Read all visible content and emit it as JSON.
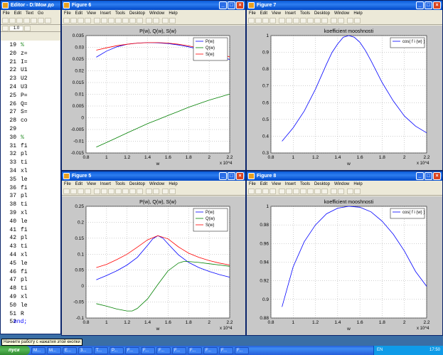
{
  "editor": {
    "title": "Editor - D:\\Мои до",
    "menu": [
      "File",
      "Edit",
      "Text",
      "Go"
    ],
    "zoom_value": "1.0",
    "lines": [
      {
        "n": "19",
        "t": "%"
      },
      {
        "n": "20",
        "t": "z="
      },
      {
        "n": "21",
        "t": "I="
      },
      {
        "n": "22",
        "t": "U1"
      },
      {
        "n": "23",
        "t": "U2"
      },
      {
        "n": "24",
        "t": "U3"
      },
      {
        "n": "25",
        "t": "P="
      },
      {
        "n": "26",
        "t": "Q="
      },
      {
        "n": "27",
        "t": "S="
      },
      {
        "n": "28",
        "t": "co"
      },
      {
        "n": "29",
        "t": ""
      },
      {
        "n": "30",
        "t": "%"
      },
      {
        "n": "31",
        "t": "fi"
      },
      {
        "n": "32",
        "t": "pl"
      },
      {
        "n": "33",
        "t": "ti"
      },
      {
        "n": "34",
        "t": "xl"
      },
      {
        "n": "35",
        "t": "le"
      },
      {
        "n": "36",
        "t": "fi"
      },
      {
        "n": "37",
        "t": "pl"
      },
      {
        "n": "38",
        "t": "ti"
      },
      {
        "n": "39",
        "t": "xl"
      },
      {
        "n": "40",
        "t": "le"
      },
      {
        "n": "41",
        "t": "fi"
      },
      {
        "n": "42",
        "t": "pl"
      },
      {
        "n": "43",
        "t": "ti"
      },
      {
        "n": "44",
        "t": "xl"
      },
      {
        "n": "45",
        "t": "le"
      },
      {
        "n": "46",
        "t": "fi"
      },
      {
        "n": "47",
        "t": "pl"
      },
      {
        "n": "48",
        "t": "ti"
      },
      {
        "n": "49",
        "t": "xl"
      },
      {
        "n": "50",
        "t": "le"
      },
      {
        "n": "51",
        "t": "R"
      },
      {
        "n": "52",
        "t": "end;"
      }
    ]
  },
  "figure_menu": [
    "File",
    "Edit",
    "View",
    "Insert",
    "Tools",
    "Desktop",
    "Window",
    "Help"
  ],
  "figures": {
    "fig6": {
      "title": "Figure 6"
    },
    "fig7": {
      "title": "Figure 7"
    },
    "fig5": {
      "title": "Figure 5"
    },
    "fig8": {
      "title": "Figure 8"
    }
  },
  "chart_data": [
    {
      "id": "fig6",
      "type": "line",
      "title": "P(w), Q(w), S(w)",
      "xlabel": "w",
      "x_exponent": "x 10^4",
      "xlim": [
        0.8,
        2.2
      ],
      "ylim": [
        -0.015,
        0.035
      ],
      "xticks": [
        "0.8",
        "1",
        "1.2",
        "1.4",
        "1.6",
        "1.8",
        "2",
        "2.2"
      ],
      "yticks": [
        "-0.015",
        "-0.01",
        "-0.005",
        "0",
        "0.005",
        "0.01",
        "0.015",
        "0.02",
        "0.025",
        "0.03",
        "0.035"
      ],
      "legend": "top-right",
      "grid": true,
      "series": [
        {
          "name": "P(w)",
          "color": "#0000ff",
          "x": [
            0.9,
            1.0,
            1.1,
            1.2,
            1.3,
            1.4,
            1.5,
            1.6,
            1.7,
            1.8,
            1.9,
            2.0,
            2.1,
            2.2
          ],
          "y": [
            0.0258,
            0.0284,
            0.0302,
            0.0313,
            0.0318,
            0.032,
            0.0319,
            0.0316,
            0.031,
            0.0302,
            0.0292,
            0.0279,
            0.0264,
            0.0248
          ]
        },
        {
          "name": "Q(w)",
          "color": "#008000",
          "x": [
            0.9,
            1.0,
            1.1,
            1.2,
            1.3,
            1.4,
            1.5,
            1.6,
            1.7,
            1.8,
            1.9,
            2.0,
            2.1,
            2.2
          ],
          "y": [
            -0.0125,
            -0.0105,
            -0.0085,
            -0.0065,
            -0.0045,
            -0.0025,
            -0.0008,
            0.001,
            0.0027,
            0.0045,
            0.006,
            0.0075,
            0.0088,
            0.0101
          ]
        },
        {
          "name": "S(w)",
          "color": "#ff0000",
          "x": [
            0.9,
            1.0,
            1.1,
            1.2,
            1.3,
            1.4,
            1.5,
            1.6,
            1.7,
            1.8,
            1.9,
            2.0,
            2.1,
            2.2
          ],
          "y": [
            0.0288,
            0.0298,
            0.0307,
            0.0313,
            0.0318,
            0.032,
            0.032,
            0.0318,
            0.0313,
            0.0306,
            0.0297,
            0.0286,
            0.0273,
            0.0259
          ]
        }
      ]
    },
    {
      "id": "fig7",
      "type": "line",
      "title": "koefficient mooshnosti",
      "xlabel": "w",
      "x_exponent": "x 10^4",
      "xlim": [
        0.8,
        2.2
      ],
      "ylim": [
        0.3,
        1.0
      ],
      "xticks": [
        "0.8",
        "1",
        "1.2",
        "1.4",
        "1.6",
        "1.8",
        "2",
        "2.2"
      ],
      "yticks": [
        "0.3",
        "0.4",
        "0.5",
        "0.6",
        "0.7",
        "0.8",
        "0.9",
        "1"
      ],
      "legend": "top-right",
      "grid": true,
      "series": [
        {
          "name": "cos( f i (w) )",
          "color": "#0000ff",
          "x": [
            0.9,
            1.0,
            1.1,
            1.2,
            1.3,
            1.35,
            1.4,
            1.45,
            1.5,
            1.55,
            1.6,
            1.65,
            1.7,
            1.8,
            1.9,
            2.0,
            2.1,
            2.2
          ],
          "y": [
            0.37,
            0.45,
            0.55,
            0.68,
            0.83,
            0.9,
            0.95,
            0.99,
            1.0,
            0.99,
            0.96,
            0.91,
            0.85,
            0.72,
            0.61,
            0.52,
            0.46,
            0.42
          ]
        }
      ]
    },
    {
      "id": "fig5",
      "type": "line",
      "title": "P(w), Q(w), S(w)",
      "xlabel": "w",
      "x_exponent": "x 10^4",
      "xlim": [
        0.8,
        2.2
      ],
      "ylim": [
        -0.1,
        0.25
      ],
      "xticks": [
        "0.8",
        "1",
        "1.2",
        "1.4",
        "1.6",
        "1.8",
        "2",
        "2.2"
      ],
      "yticks": [
        "-0.1",
        "-0.05",
        "0",
        "0.05",
        "0.1",
        "0.15",
        "0.2",
        "0.25"
      ],
      "legend": "top-right",
      "grid": true,
      "series": [
        {
          "name": "P(w)",
          "color": "#0000ff",
          "x": [
            0.9,
            1.0,
            1.1,
            1.2,
            1.3,
            1.4,
            1.45,
            1.5,
            1.55,
            1.6,
            1.7,
            1.8,
            1.9,
            2.0,
            2.1,
            2.2
          ],
          "y": [
            0.02,
            0.033,
            0.048,
            0.066,
            0.09,
            0.128,
            0.148,
            0.158,
            0.15,
            0.132,
            0.098,
            0.074,
            0.058,
            0.046,
            0.036,
            0.028
          ]
        },
        {
          "name": "Q(w)",
          "color": "#008000",
          "x": [
            0.9,
            1.0,
            1.1,
            1.2,
            1.25,
            1.3,
            1.4,
            1.5,
            1.6,
            1.7,
            1.75,
            1.8,
            1.9,
            2.0,
            2.1,
            2.2
          ],
          "y": [
            -0.055,
            -0.063,
            -0.072,
            -0.078,
            -0.078,
            -0.07,
            -0.04,
            0.005,
            0.048,
            0.072,
            0.077,
            0.077,
            0.074,
            0.07,
            0.066,
            0.062
          ]
        },
        {
          "name": "S(w)",
          "color": "#ff0000",
          "x": [
            0.9,
            1.0,
            1.1,
            1.2,
            1.3,
            1.4,
            1.5,
            1.6,
            1.7,
            1.8,
            1.9,
            2.0,
            2.1,
            2.2
          ],
          "y": [
            0.058,
            0.068,
            0.083,
            0.1,
            0.122,
            0.145,
            0.158,
            0.148,
            0.123,
            0.103,
            0.09,
            0.08,
            0.072,
            0.066
          ]
        }
      ]
    },
    {
      "id": "fig8",
      "type": "line",
      "title": "koefficient mooshnosti",
      "xlabel": "w",
      "x_exponent": "x 10^4",
      "xlim": [
        0.8,
        2.2
      ],
      "ylim": [
        0.88,
        1.0
      ],
      "xticks": [
        "0.8",
        "1",
        "1.2",
        "1.4",
        "1.6",
        "1.8",
        "2",
        "2.2"
      ],
      "yticks": [
        "0.88",
        "0.9",
        "0.92",
        "0.94",
        "0.96",
        "0.98",
        "1"
      ],
      "legend": "top-right",
      "grid": true,
      "series": [
        {
          "name": "cos( f i (w) )",
          "color": "#0000ff",
          "x": [
            0.9,
            1.0,
            1.1,
            1.2,
            1.3,
            1.4,
            1.5,
            1.6,
            1.7,
            1.8,
            1.9,
            2.0,
            2.1,
            2.2
          ],
          "y": [
            0.892,
            0.935,
            0.962,
            0.98,
            0.992,
            0.998,
            1.0,
            0.999,
            0.994,
            0.984,
            0.97,
            0.952,
            0.93,
            0.914
          ]
        }
      ]
    }
  ],
  "tooltip": "Начните работу с нажатия этой кнопки",
  "taskbar": {
    "start_label": "пуск",
    "buttons": [
      "M...",
      "M...",
      "E...",
      "3...",
      "T...",
      "P...",
      "F...",
      "F...",
      "F...",
      "F...",
      "F...",
      "F...",
      "F...",
      "F..."
    ],
    "lang": "EN",
    "clock": "17:50"
  }
}
